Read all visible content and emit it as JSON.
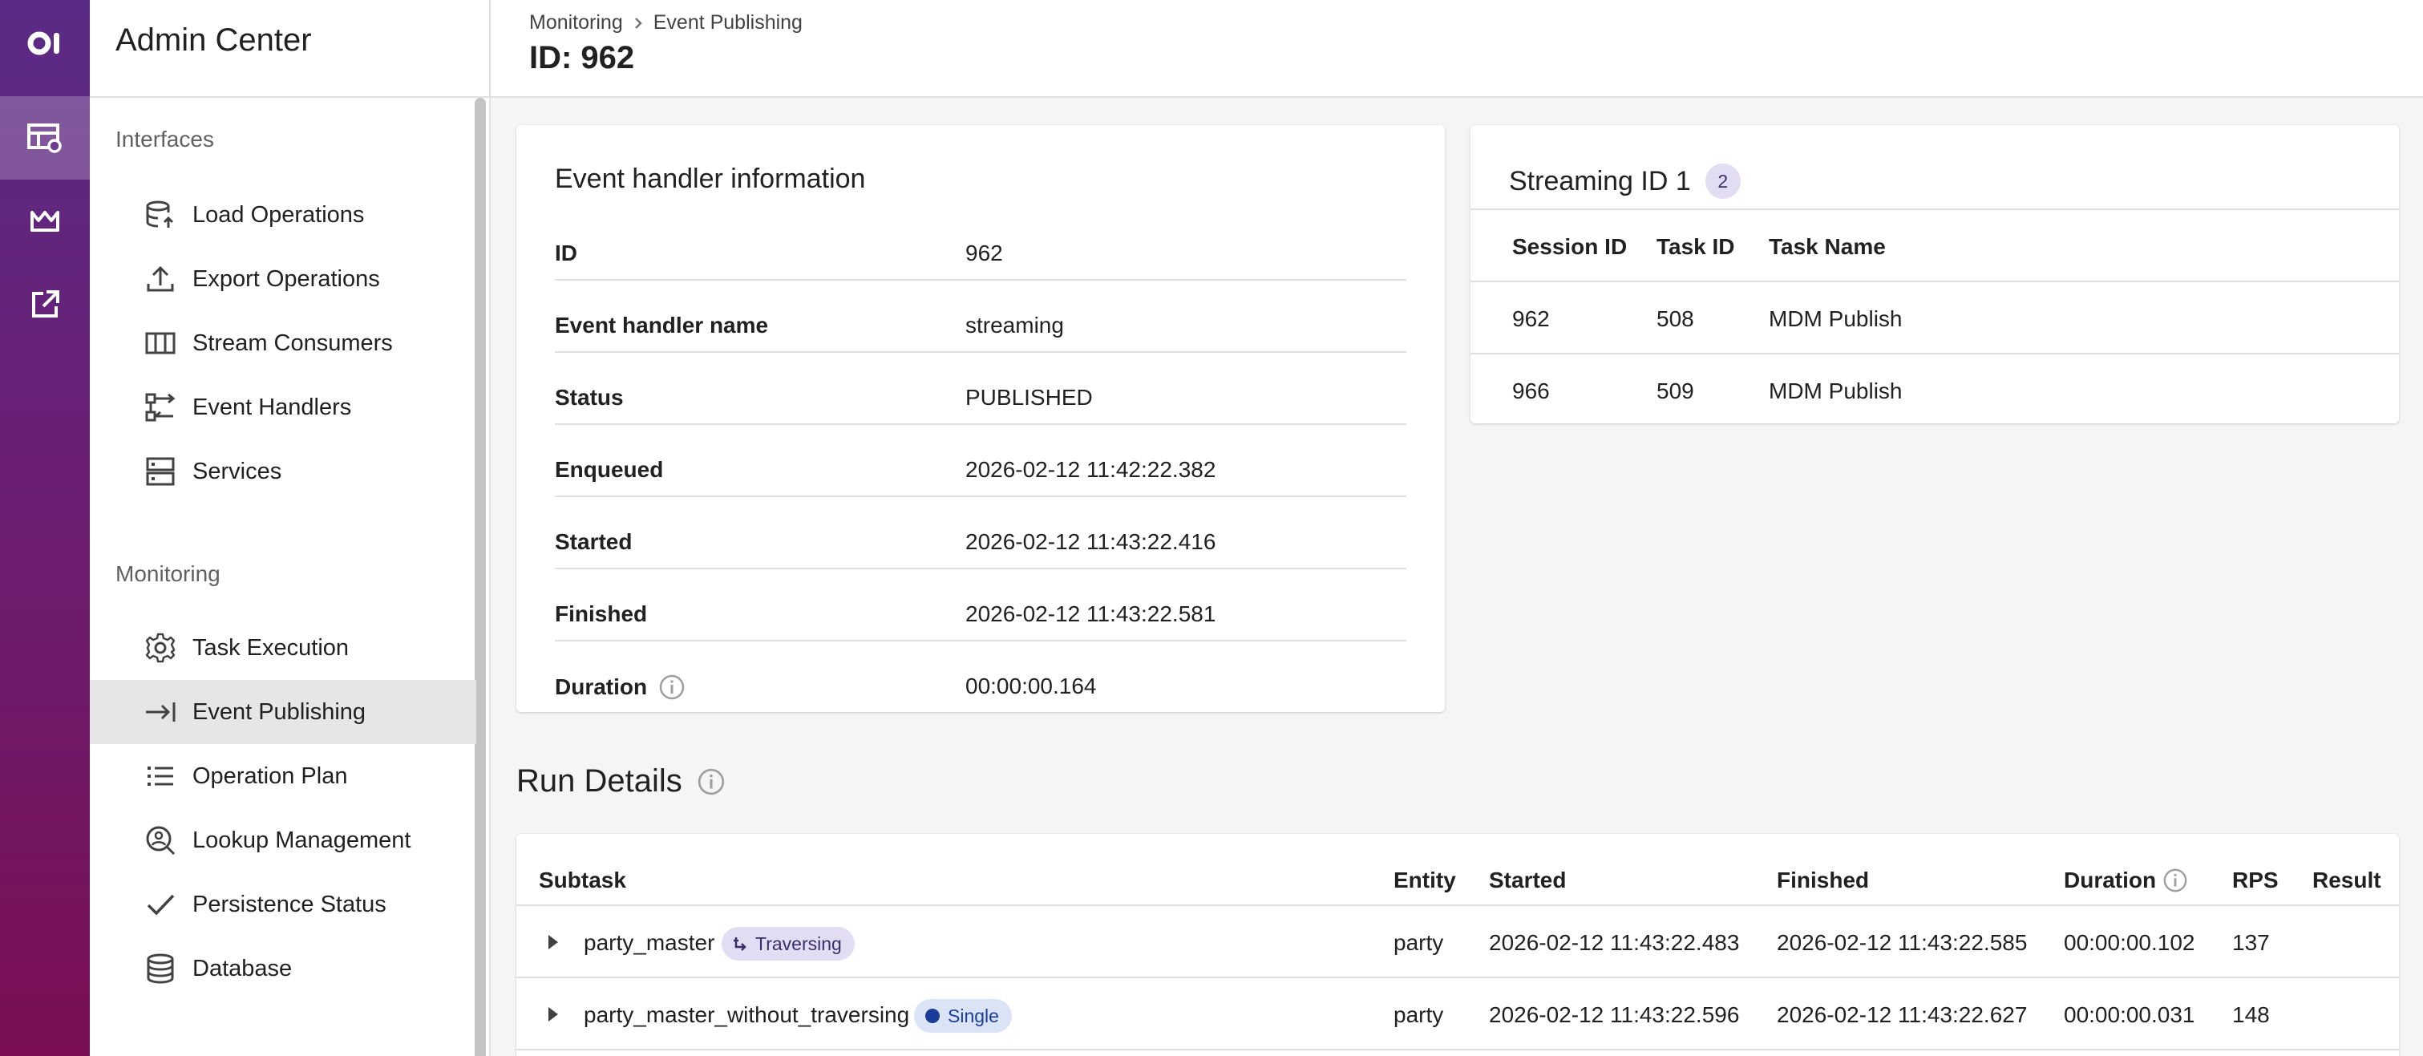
{
  "app": {
    "title": "Admin Center"
  },
  "sidebar": {
    "sections": [
      {
        "label": "Interfaces"
      },
      {
        "label": "Monitoring"
      }
    ],
    "interfaces": [
      {
        "label": "Load Operations",
        "icon": "database-upload-icon"
      },
      {
        "label": "Export Operations",
        "icon": "upload-icon"
      },
      {
        "label": "Stream Consumers",
        "icon": "columns-icon"
      },
      {
        "label": "Event Handlers",
        "icon": "handler-icon"
      },
      {
        "label": "Services",
        "icon": "server-icon"
      }
    ],
    "monitoring": [
      {
        "label": "Task Execution",
        "icon": "gear-icon"
      },
      {
        "label": "Event Publishing",
        "icon": "arrow-to-bar-icon",
        "active": true
      },
      {
        "label": "Operation Plan",
        "icon": "list-icon"
      },
      {
        "label": "Lookup Management",
        "icon": "lookup-icon"
      },
      {
        "label": "Persistence Status",
        "icon": "check-icon"
      },
      {
        "label": "Database",
        "icon": "database-icon"
      }
    ]
  },
  "header": {
    "breadcrumb": [
      "Monitoring",
      "Event Publishing"
    ],
    "title": "ID: 962"
  },
  "handler_card": {
    "title": "Event handler information",
    "rows": [
      {
        "key": "ID",
        "value": "962"
      },
      {
        "key": "Event handler name",
        "value": "streaming"
      },
      {
        "key": "Status",
        "value": "PUBLISHED"
      },
      {
        "key": "Enqueued",
        "value": "2026-02-12 11:42:22.382"
      },
      {
        "key": "Started",
        "value": "2026-02-12 11:43:22.416"
      },
      {
        "key": "Finished",
        "value": "2026-02-12 11:43:22.581"
      },
      {
        "key": "Duration",
        "value": "00:00:00.164"
      }
    ]
  },
  "streaming_card": {
    "title": "Streaming ID 1",
    "count": "2",
    "columns": [
      "Session ID",
      "Task ID",
      "Task Name"
    ],
    "rows": [
      [
        "962",
        "508",
        "MDM Publish"
      ],
      [
        "966",
        "509",
        "MDM Publish"
      ]
    ]
  },
  "run_details": {
    "title": "Run Details",
    "columns": [
      "Subtask",
      "Entity",
      "Started",
      "Finished",
      "Duration",
      "RPS",
      "Result"
    ],
    "rows": [
      {
        "subtask": "party_master",
        "tag": "Traversing",
        "entity": "party",
        "started": "2026-02-12 11:43:22.483",
        "finished": "2026-02-12 11:43:22.585",
        "duration": "00:00:00.102",
        "rps": "137",
        "result": ""
      },
      {
        "subtask": "party_master_without_traversing",
        "tag": "Single",
        "entity": "party",
        "started": "2026-02-12 11:43:22.596",
        "finished": "2026-02-12 11:43:22.627",
        "duration": "00:00:00.031",
        "rps": "148",
        "result": ""
      }
    ]
  },
  "colors": {
    "rail_top": "#5a2b86",
    "rail_bottom": "#7a0f55",
    "active_nav": "#e6e6e6",
    "chip_traversing": "#e3ddf4",
    "chip_single": "#dbe4f7"
  }
}
